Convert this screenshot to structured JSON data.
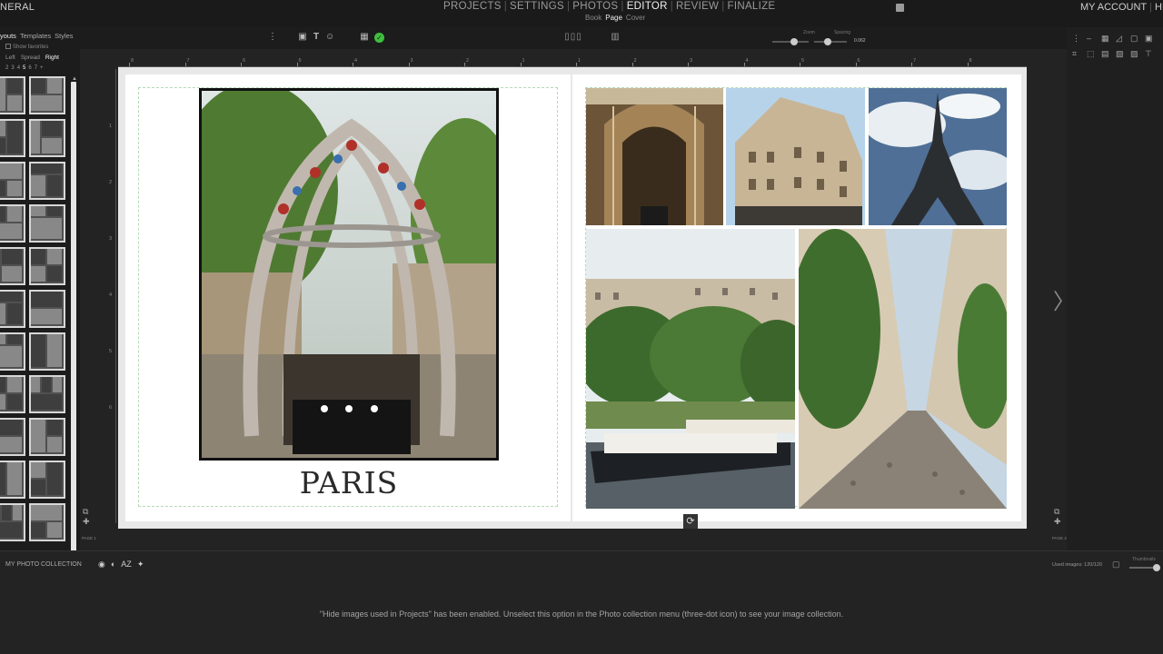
{
  "nav": {
    "left_label": "NERAL",
    "items": [
      "PROJECTS",
      "SETTINGS",
      "PHOTOS",
      "EDITOR",
      "REVIEW",
      "FINALIZE"
    ],
    "active": "EDITOR",
    "sub_items": [
      "Book",
      "Page",
      "Cover"
    ],
    "sub_active": "Page",
    "account": "MY ACCOUNT",
    "help_partial": "HE"
  },
  "left_panel": {
    "tabs": [
      "youts",
      "Templates",
      "Styles"
    ],
    "active_tab": "youts",
    "favorites_label": "Show favorites",
    "sides": [
      "Left",
      "Spread",
      "Right"
    ],
    "active_side": "Right",
    "counts": [
      "2",
      "3",
      "4",
      "5",
      "6",
      "7+"
    ],
    "active_count": "5"
  },
  "toolbar": {
    "zoom_label": "Zoom",
    "spacing_label": "Spacing",
    "spacing_value": "0.062"
  },
  "canvas": {
    "title": "PARIS",
    "photos": [
      "metro-entrance",
      "covered-arcade",
      "haussmann-building",
      "eiffel-tower",
      "seine-houseboat",
      "ivy-street"
    ]
  },
  "ruler": {
    "labels_h": [
      "8",
      "7",
      "6",
      "5",
      "4",
      "3",
      "2",
      "1",
      "1",
      "2",
      "3",
      "4",
      "5",
      "6",
      "7",
      "8"
    ],
    "labels_v": [
      "1",
      "2",
      "3",
      "4",
      "5",
      "6"
    ]
  },
  "page_labels": {
    "left": "PAGE 1",
    "right": "PAGE 2"
  },
  "bottom": {
    "collection_title": "MY PHOTO COLLECTION",
    "sort_label": "AZ",
    "used_images": "Used images: 120/120",
    "thumbnails_label": "Thumbnails",
    "message": "\"Hide images used in Projects\" has been enabled. Unselect this option in the Photo collection menu (three-dot icon) to see your image collection."
  },
  "colors": {
    "background": "#1c1c1c",
    "accent_green": "#3fbf3f",
    "page": "#ffffff"
  }
}
